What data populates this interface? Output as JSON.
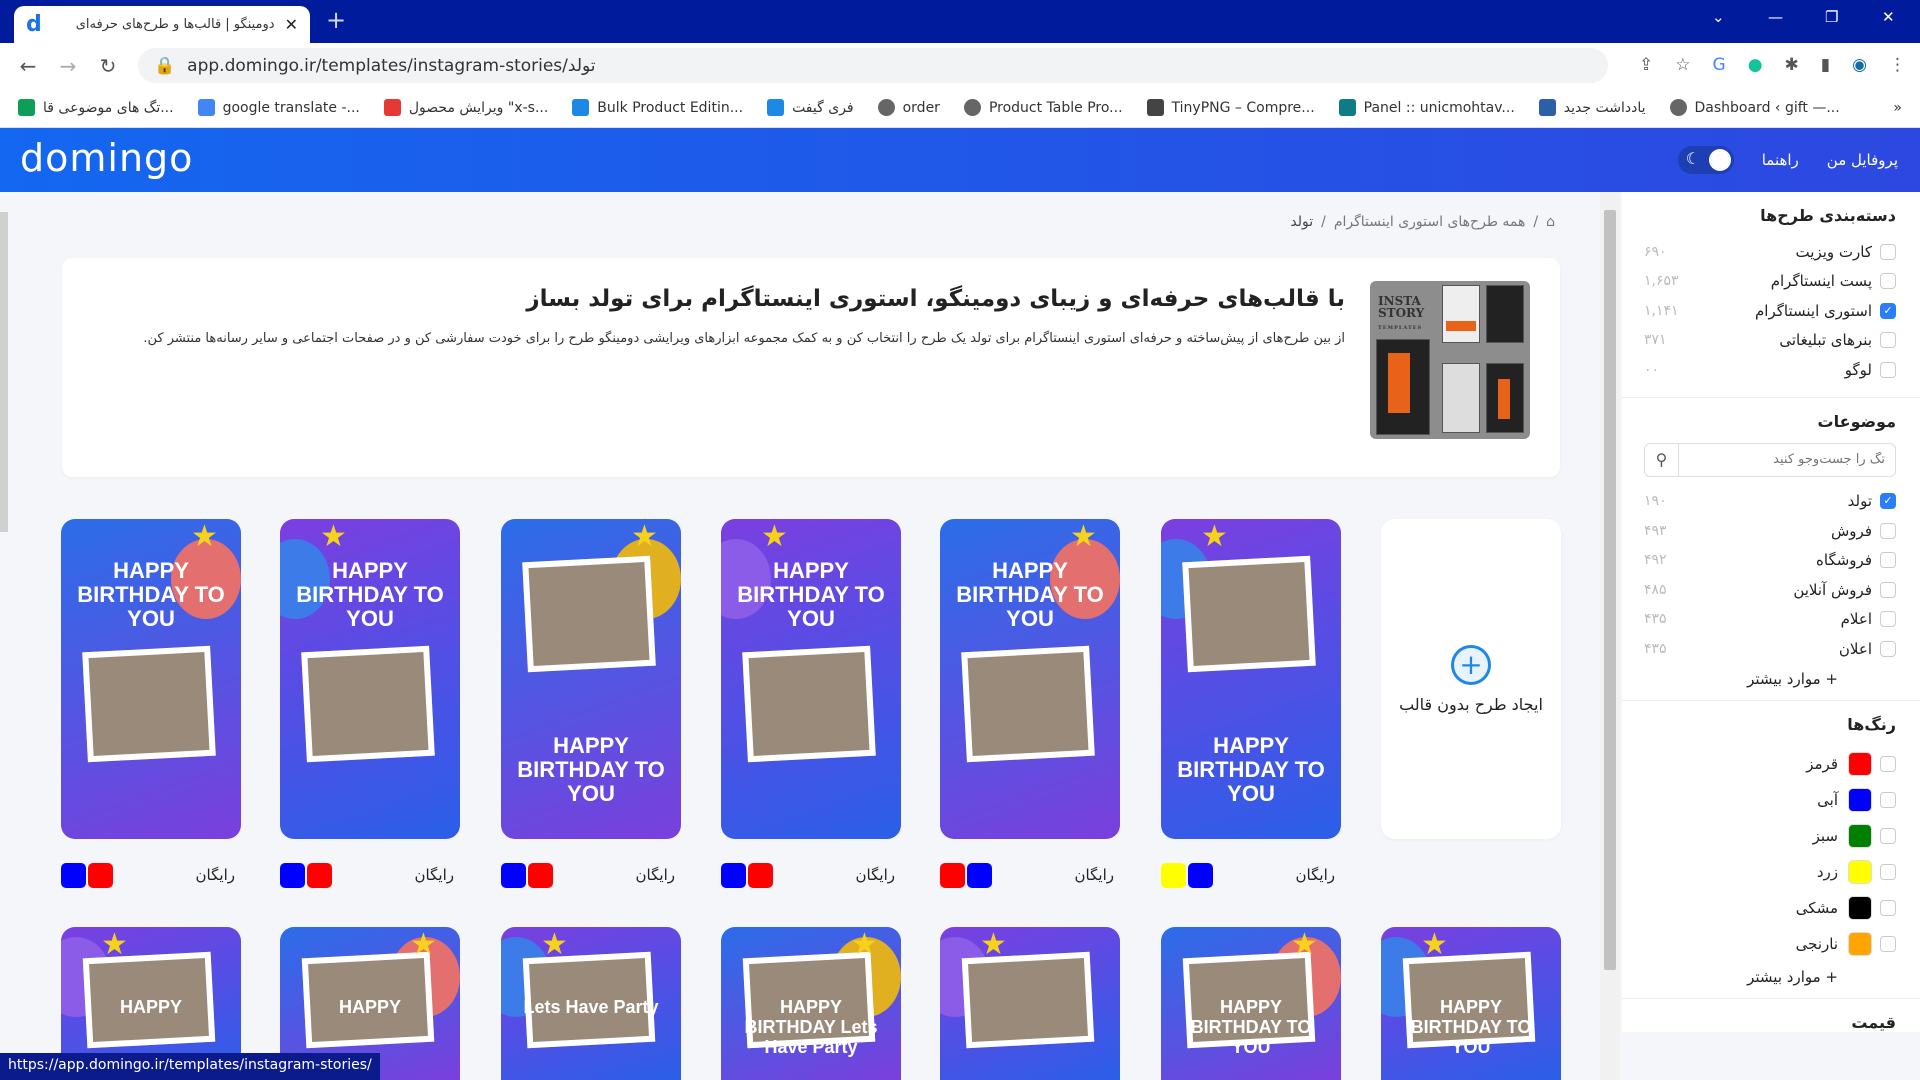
{
  "browser": {
    "tab_title": "دومینگو | قالب‌ها و طرح‌های حرفه‌ای",
    "url": "app.domingo.ir/templates/instagram-stories/تولد",
    "bookmarks": [
      {
        "label": "تگ های موضوعی قا...",
        "icon": "sheets-icon",
        "color": "#0f9d58"
      },
      {
        "label": "google translate -...",
        "icon": "google-icon",
        "color": "#4285f4"
      },
      {
        "label": "ویرایش محصول \"x-s...",
        "icon": "star-icon",
        "color": "#e53935"
      },
      {
        "label": "Bulk Product Editin...",
        "icon": "it-icon",
        "color": "#1e88e5"
      },
      {
        "label": "فری گیفت",
        "icon": "it-icon",
        "color": "#1e88e5"
      },
      {
        "label": "order",
        "icon": "globe-icon",
        "color": "#666666"
      },
      {
        "label": "Product Table Pro...",
        "icon": "globe-icon",
        "color": "#666666"
      },
      {
        "label": "TinyPNG – Compre...",
        "icon": "panda-icon",
        "color": "#444444"
      },
      {
        "label": "Panel :: unicmohtav...",
        "icon": "bayan-icon",
        "color": "#0e7c86"
      },
      {
        "label": "یادداشت جدید",
        "icon": "note-icon",
        "color": "#2b5fa8"
      },
      {
        "label": "Dashboard ‹ gift —...",
        "icon": "globe-icon",
        "color": "#666666"
      }
    ],
    "status_url": "https://app.domingo.ir/templates/instagram-stories/"
  },
  "header": {
    "logo": "domingo",
    "profile": "پروفایل من",
    "guide": "راهنما",
    "dark_mode": true
  },
  "breadcrumb": {
    "all": "همه طرح‌های استوری اینستاگرام",
    "current": "تولد",
    "sep": "/"
  },
  "hero": {
    "title": "با قالب‌های حرفه‌ای و زیبای دومینگو، استوری اینستاگرام برای تولد بساز",
    "description": "از بین طرح‌های از پیش‌ساخته و حرفه‌ای استوری اینستاگرام برای تولد یک طرح را انتخاب کن و به کمک مجموعه ابزارهای ویرایشی دومینگو طرح را برای خودت سفارشی کن و در صفحات اجتماعی و سایر رسانه‌ها منتشر کن.",
    "image_text": "INSTA STORY TEMPLATES"
  },
  "blank_card": {
    "label": "ایجاد طرح بدون قالب"
  },
  "cards": [
    {
      "price": "رایگان",
      "colors": [
        "#ffff00",
        "#0000ff"
      ],
      "text": "HAPPY BIRTHDAY TO YOU"
    },
    {
      "price": "رایگان",
      "colors": [
        "#ff0000",
        "#0000ff"
      ],
      "text": "HAPPY BIRTHDAY TO YOU"
    },
    {
      "price": "رایگان",
      "colors": [
        "#0000ff",
        "#ff0000"
      ],
      "text": "HAPPY BIRTHDAY TO YOU"
    },
    {
      "price": "رایگان",
      "colors": [
        "#0000ff",
        "#ff0000"
      ],
      "text": "HAPPY BIRTHDAY TO YOU"
    },
    {
      "price": "رایگان",
      "colors": [
        "#0000ff",
        "#ff0000"
      ],
      "text": "HAPPY BIRTHDAY TO YOU"
    },
    {
      "price": "رایگان",
      "colors": [
        "#0000ff",
        "#ff0000"
      ],
      "text": "HAPPY BIRTHDAY TO YOU"
    }
  ],
  "cards_row2": [
    {
      "text": "HAPPY BIRTHDAY TO YOU"
    },
    {
      "text": "HAPPY BIRTHDAY TO YOU"
    },
    {
      "text": ""
    },
    {
      "text": "HAPPY BIRTHDAY Lets Have Party"
    },
    {
      "text": "Lets Have Party"
    },
    {
      "text": "HAPPY"
    },
    {
      "text": "HAPPY"
    }
  ],
  "sidebar": {
    "categories_title": "دسته‌بندی طرح‌ها",
    "categories": [
      {
        "label": "کارت ویزیت",
        "count": "۶۹۰",
        "checked": false
      },
      {
        "label": "پست اینستاگرام",
        "count": "۱,۶۵۳",
        "checked": false
      },
      {
        "label": "استوری اینستاگرام",
        "count": "۱,۱۴۱",
        "checked": true
      },
      {
        "label": "بنرهای تبلیغاتی",
        "count": "۳۷۱",
        "checked": false
      },
      {
        "label": "لوگو",
        "count": "۰۰",
        "checked": false
      }
    ],
    "topics_title": "موضوعات",
    "topic_search_placeholder": "تگ را جست‌وجو کنید",
    "topics": [
      {
        "label": "تولد",
        "count": "۱۹۰",
        "checked": true
      },
      {
        "label": "فروش",
        "count": "۴۹۳",
        "checked": false
      },
      {
        "label": "فروشگاه",
        "count": "۴۹۲",
        "checked": false
      },
      {
        "label": "فروش آنلاین",
        "count": "۴۸۵",
        "checked": false
      },
      {
        "label": "اعلام",
        "count": "۴۳۵",
        "checked": false
      },
      {
        "label": "اعلان",
        "count": "۴۳۵",
        "checked": false
      }
    ],
    "more": "+ موارد بیشتر",
    "colors_title": "رنگ‌ها",
    "colors": [
      {
        "label": "قرمز",
        "hex": "#ff0000"
      },
      {
        "label": "آبی",
        "hex": "#0000ff"
      },
      {
        "label": "سبز",
        "hex": "#008000"
      },
      {
        "label": "زرد",
        "hex": "#ffff00"
      },
      {
        "label": "مشکی",
        "hex": "#000000"
      },
      {
        "label": "نارنجی",
        "hex": "#ffa500"
      }
    ],
    "price_title": "قیمت"
  }
}
